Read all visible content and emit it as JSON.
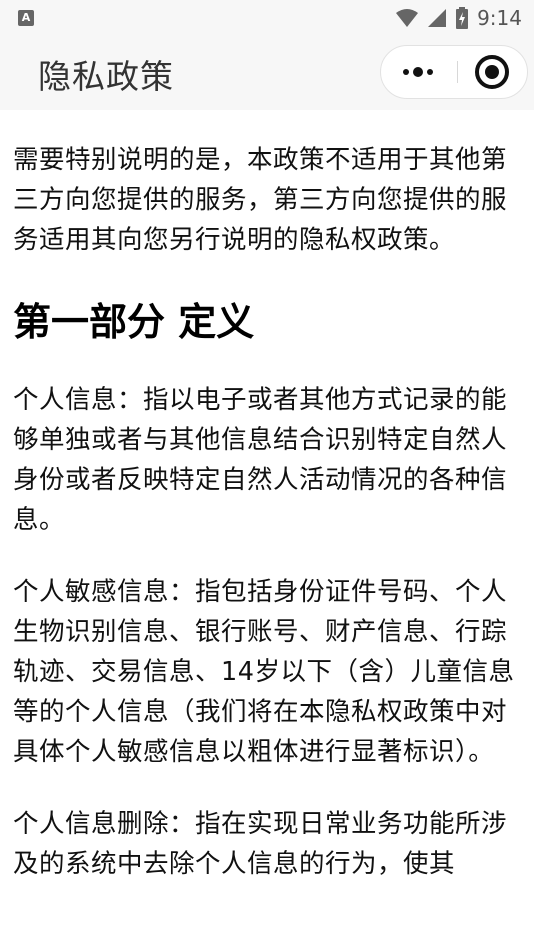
{
  "status_bar": {
    "app_icon_letter": "A",
    "time": "9:14",
    "icons": [
      "wifi-icon",
      "cellular-signal-icon",
      "battery-charging-icon"
    ]
  },
  "title_bar": {
    "title": "隐私政策",
    "capsule": {
      "menu_icon": "more-dots-icon",
      "close_icon": "target-close-icon"
    }
  },
  "content": {
    "paragraph_intro": "需要特别说明的是，本政策不适用于其他第三方向您提供的服务，第三方向您提供的服务适用其向您另行说明的隐私权政策。",
    "section_heading": "第一部分 定义",
    "paragraph_personal_info": "个人信息：指以电子或者其他方式记录的能够单独或者与其他信息结合识别特定自然人身份或者反映特定自然人活动情况的各种信息。",
    "paragraph_sensitive_info": "个人敏感信息：指包括身份证件号码、个人生物识别信息、银行账号、财产信息、行踪轨迹、交易信息、14岁以下（含）儿童信息等的个人信息（我们将在本隐私权政策中对具体个人敏感信息以粗体进行显著标识）。",
    "paragraph_deletion": "个人信息删除：指在实现日常业务功能所涉及的系统中去除个人信息的行为，使其"
  }
}
